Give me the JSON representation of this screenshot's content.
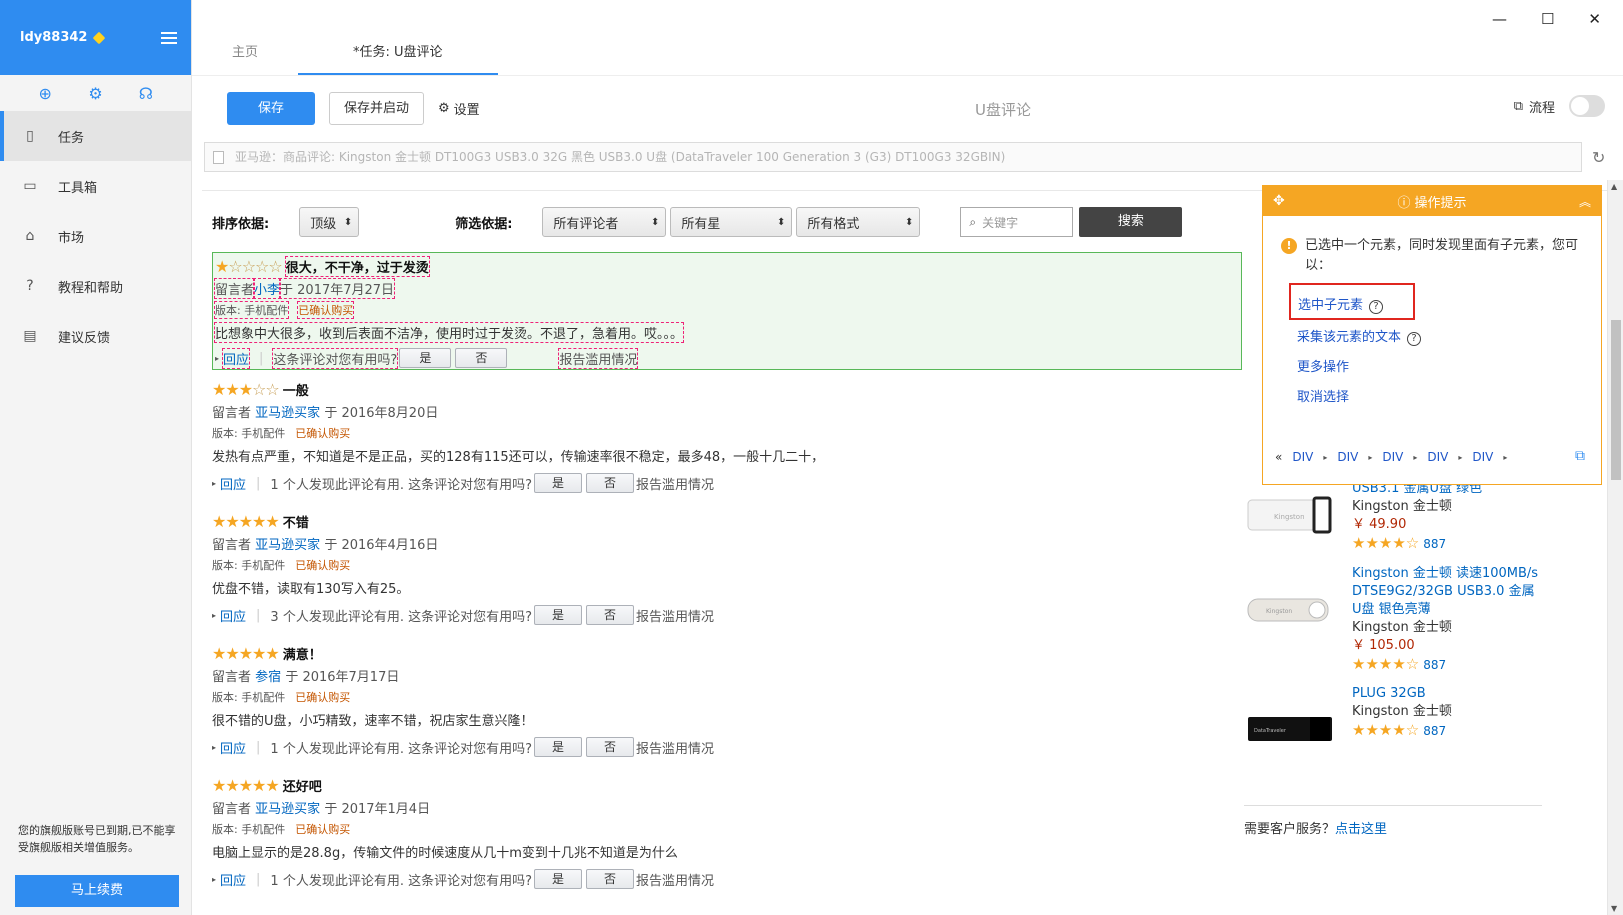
{
  "sidebar": {
    "username": "ldy88342",
    "items": [
      {
        "label": "任务"
      },
      {
        "label": "工具箱"
      },
      {
        "label": "市场"
      },
      {
        "label": "教程和帮助"
      },
      {
        "label": "建议反馈"
      }
    ],
    "notice": "您的旗舰版账号已到期,已不能享受旗舰版相关增值服务。",
    "renew_label": "马上续费"
  },
  "window": {
    "minimize": "—",
    "maximize": "☐",
    "close": "✕"
  },
  "tabs": [
    {
      "label": "主页"
    },
    {
      "label": "*任务: U盘评论"
    }
  ],
  "toolbar": {
    "save_label": "保存",
    "save_start_label": "保存并启动",
    "settings_label": "设置",
    "page_title": "U盘评论",
    "flow_label": "流程"
  },
  "urlbar": {
    "text": "亚马逊：商品评论: Kingston 金士顿 DT100G3 USB3.0 32G 黑色 USB3.0 U盘 (DataTraveler 100 Generation 3 (G3) DT100G3 32GBIN)"
  },
  "filters": {
    "sort_label": "排序依据:",
    "sort_value": "顶级",
    "filter_label": "筛选依据:",
    "reviewer_value": "所有评论者",
    "star_value": "所有星",
    "format_value": "所有格式",
    "search_placeholder": "关键字",
    "search_button": "搜索"
  },
  "reviews": [
    {
      "stars": 1,
      "title": "很大，不干净，过于发烫",
      "by": "留言者",
      "author": "小李",
      "date": "于 2017年7月27日",
      "version": "版本: 手机配件",
      "verified": "已确认购买",
      "body": "比想象中大很多，收到后表面不洁净，使用时过于发烫。不退了，急着用。哎。。。",
      "reply": "回应",
      "helpful": "这条评论对您有用吗?",
      "yes": "是",
      "no": "否",
      "report": "报告滥用情况"
    },
    {
      "stars": 3,
      "title": "一般",
      "by": "留言者",
      "author": "亚马逊买家",
      "date": "于 2016年8月20日",
      "version": "版本: 手机配件",
      "verified": "已确认购买",
      "body": "发热有点严重，不知道是不是正品，买的128有115还可以，传输速率很不稳定，最多48，一般十几二十，",
      "reply": "回应",
      "helpful": "1 个人发现此评论有用. 这条评论对您有用吗?",
      "yes": "是",
      "no": "否",
      "report": "报告滥用情况"
    },
    {
      "stars": 5,
      "title": "不错",
      "by": "留言者",
      "author": "亚马逊买家",
      "date": "于 2016年4月16日",
      "version": "版本: 手机配件",
      "verified": "已确认购买",
      "body": "优盘不错，读取有130写入有25。",
      "reply": "回应",
      "helpful": "3 个人发现此评论有用. 这条评论对您有用吗?",
      "yes": "是",
      "no": "否",
      "report": "报告滥用情况"
    },
    {
      "stars": 5,
      "title": "满意！",
      "by": "留言者",
      "author": "参宿",
      "date": "于 2016年7月17日",
      "version": "版本: 手机配件",
      "verified": "已确认购买",
      "body": "很不错的U盘，小巧精致，速率不错，祝店家生意兴隆！",
      "reply": "回应",
      "helpful": "1 个人发现此评论有用. 这条评论对您有用吗?",
      "yes": "是",
      "no": "否",
      "report": "报告滥用情况"
    },
    {
      "stars": 5,
      "title": "还好吧",
      "by": "留言者",
      "author": "亚马逊买家",
      "date": "于 2017年1月4日",
      "version": "版本: 手机配件",
      "verified": "已确认购买",
      "body": "电脑上显示的是28.8g，传输文件的时候速度从几十m变到十几兆不知道是为什么",
      "reply": "回应",
      "helpful": "1 个人发现此评论有用. 这条评论对您有用吗?",
      "yes": "是",
      "no": "否",
      "report": "报告滥用情况"
    }
  ],
  "products": [
    {
      "title": "USB3.1 金属U盘 绿色",
      "brand": "Kingston 金士顿",
      "price": "￥ 49.90",
      "rating": 4,
      "count": "887"
    },
    {
      "title": "Kingston 金士顿 读速100MB/s DTSE9G2/32GB USB3.0 金属U盘 银色亮薄",
      "brand": "Kingston 金士顿",
      "price": "￥ 105.00",
      "rating": 4,
      "count": "887"
    },
    {
      "title": "PLUG 32GB",
      "brand": "Kingston 金士顿",
      "price": "",
      "rating": 4,
      "count": "887"
    }
  ],
  "help": {
    "text": "需要客户服务？",
    "link": "点击这里"
  },
  "tips": {
    "title": "操作提示",
    "message": "已选中一个元素，同时发现里面有子元素，您可以：",
    "actions": [
      "选中子元素",
      "采集该元素的文本",
      "更多操作",
      "取消选择"
    ],
    "crumbs": [
      "DIV",
      "DIV",
      "DIV",
      "DIV",
      "DIV"
    ]
  },
  "colors": {
    "accent": "#2f8cf0",
    "tips": "#f5a623",
    "link": "#0066c0",
    "selection": "#58b858"
  }
}
